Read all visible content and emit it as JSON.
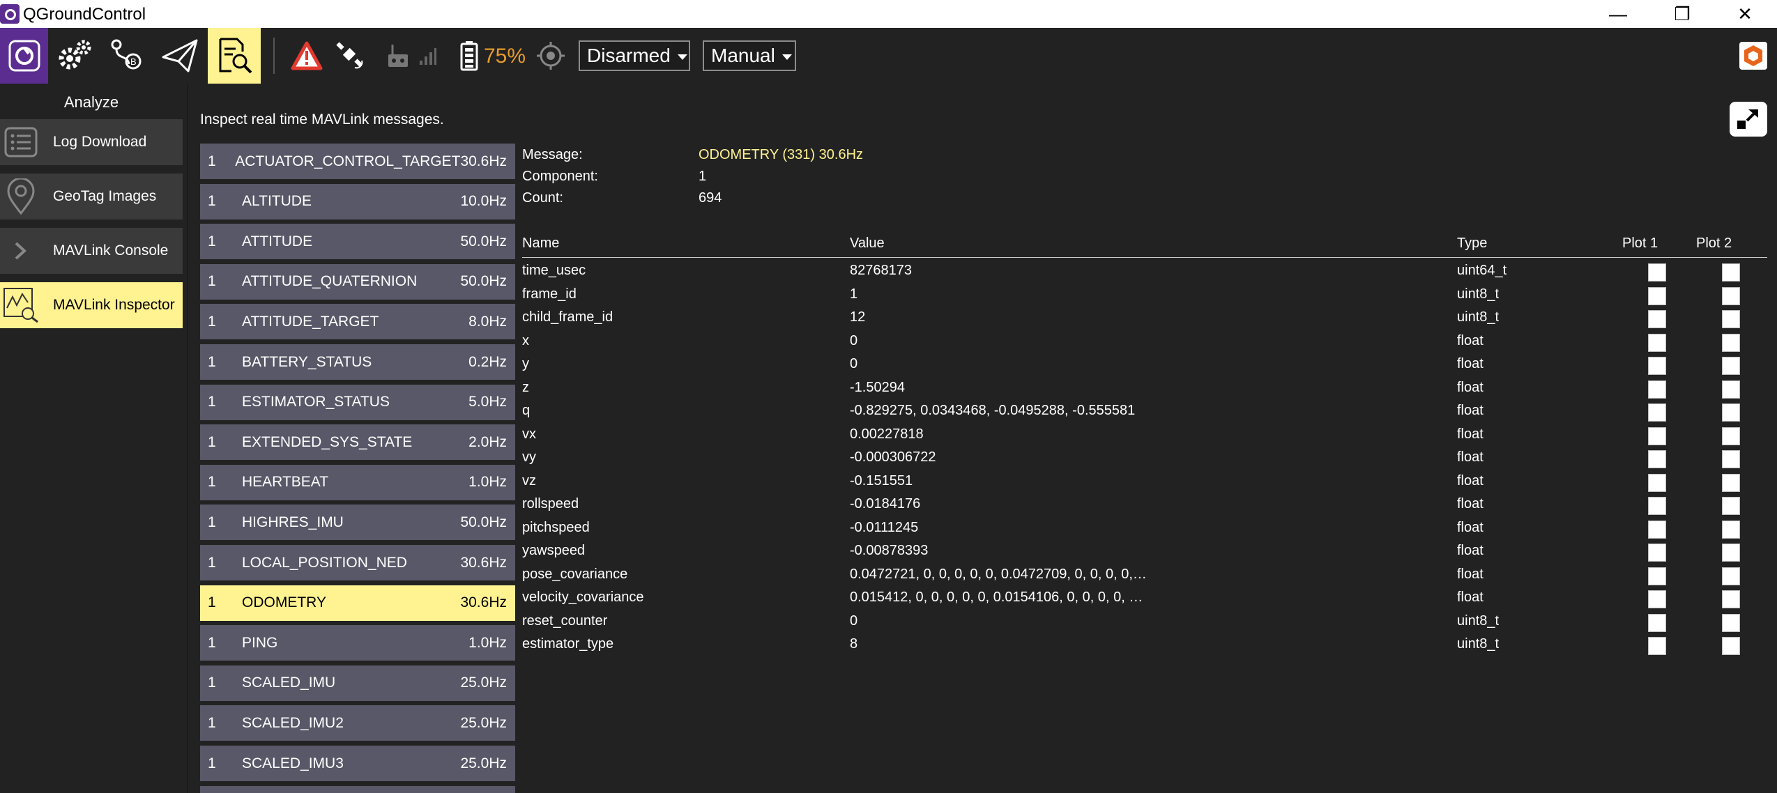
{
  "window": {
    "title": "QGroundControl",
    "minimize_glyph": "—",
    "maximize_glyph": "❐",
    "close_glyph": "✕"
  },
  "toolbar": {
    "battery_percent": "75%",
    "arm_state": "Disarmed",
    "flight_mode": "Manual",
    "icons": [
      "qgc-logo-icon",
      "vehicle-setup-icon",
      "plan-icon",
      "fly-icon",
      "analyze-icon",
      "warning-icon",
      "gps-icon",
      "rc-rssi-icon",
      "signal-bars-icon",
      "battery-icon",
      "gimbal-icon",
      "brand-icon"
    ],
    "accent_color": "#fff291",
    "warning_color": "#e23a2f",
    "battery_color": "#e79c2a"
  },
  "sidebar": {
    "title": "Analyze",
    "items": [
      {
        "label": "Log Download",
        "icon": "list-icon"
      },
      {
        "label": "GeoTag Images",
        "icon": "map-pin-icon"
      },
      {
        "label": "MAVLink Console",
        "icon": "chevron-right-icon"
      },
      {
        "label": "MAVLink Inspector",
        "icon": "inspector-chart-icon",
        "active": true
      }
    ]
  },
  "main": {
    "description": "Inspect real time MAVLink messages."
  },
  "messages": [
    {
      "sys": "1",
      "name": "ACTUATOR_CONTROL_TARGET",
      "hz": "30.6Hz"
    },
    {
      "sys": "1",
      "name": "ALTITUDE",
      "hz": "10.0Hz"
    },
    {
      "sys": "1",
      "name": "ATTITUDE",
      "hz": "50.0Hz"
    },
    {
      "sys": "1",
      "name": "ATTITUDE_QUATERNION",
      "hz": "50.0Hz"
    },
    {
      "sys": "1",
      "name": "ATTITUDE_TARGET",
      "hz": "8.0Hz"
    },
    {
      "sys": "1",
      "name": "BATTERY_STATUS",
      "hz": "0.2Hz"
    },
    {
      "sys": "1",
      "name": "ESTIMATOR_STATUS",
      "hz": "5.0Hz"
    },
    {
      "sys": "1",
      "name": "EXTENDED_SYS_STATE",
      "hz": "2.0Hz"
    },
    {
      "sys": "1",
      "name": "HEARTBEAT",
      "hz": "1.0Hz"
    },
    {
      "sys": "1",
      "name": "HIGHRES_IMU",
      "hz": "50.0Hz"
    },
    {
      "sys": "1",
      "name": "LOCAL_POSITION_NED",
      "hz": "30.6Hz"
    },
    {
      "sys": "1",
      "name": "ODOMETRY",
      "hz": "30.6Hz",
      "selected": true
    },
    {
      "sys": "1",
      "name": "PING",
      "hz": "1.0Hz"
    },
    {
      "sys": "1",
      "name": "SCALED_IMU",
      "hz": "25.0Hz"
    },
    {
      "sys": "1",
      "name": "SCALED_IMU2",
      "hz": "25.0Hz"
    },
    {
      "sys": "1",
      "name": "SCALED_IMU3",
      "hz": "25.0Hz"
    }
  ],
  "detail": {
    "message_label": "Message:",
    "message_value": "ODOMETRY (331) 30.6Hz",
    "component_label": "Component:",
    "component_value": "1",
    "count_label": "Count:",
    "count_value": "694",
    "columns": {
      "name": "Name",
      "value": "Value",
      "type": "Type",
      "plot1": "Plot 1",
      "plot2": "Plot 2"
    },
    "fields": [
      {
        "name": "time_usec",
        "value": "82768173",
        "type": "uint64_t"
      },
      {
        "name": "frame_id",
        "value": "1",
        "type": "uint8_t"
      },
      {
        "name": "child_frame_id",
        "value": "12",
        "type": "uint8_t"
      },
      {
        "name": "x",
        "value": "0",
        "type": "float"
      },
      {
        "name": "y",
        "value": "0",
        "type": "float"
      },
      {
        "name": "z",
        "value": "-1.50294",
        "type": "float"
      },
      {
        "name": "q",
        "value": "-0.829275, 0.0343468, -0.0495288, -0.555581",
        "type": "float"
      },
      {
        "name": "vx",
        "value": "0.00227818",
        "type": "float"
      },
      {
        "name": "vy",
        "value": "-0.000306722",
        "type": "float"
      },
      {
        "name": "vz",
        "value": "-0.151551",
        "type": "float"
      },
      {
        "name": "rollspeed",
        "value": "-0.0184176",
        "type": "float"
      },
      {
        "name": "pitchspeed",
        "value": "-0.0111245",
        "type": "float"
      },
      {
        "name": "yawspeed",
        "value": "-0.00878393",
        "type": "float"
      },
      {
        "name": "pose_covariance",
        "value": "0.0472721, 0, 0, 0, 0, 0, 0.0472709, 0, 0, 0, 0,…",
        "type": "float"
      },
      {
        "name": "velocity_covariance",
        "value": "0.015412, 0, 0, 0, 0, 0, 0.0154106, 0, 0, 0, 0, …",
        "type": "float"
      },
      {
        "name": "reset_counter",
        "value": "0",
        "type": "uint8_t"
      },
      {
        "name": "estimator_type",
        "value": "8",
        "type": "uint8_t"
      }
    ]
  }
}
